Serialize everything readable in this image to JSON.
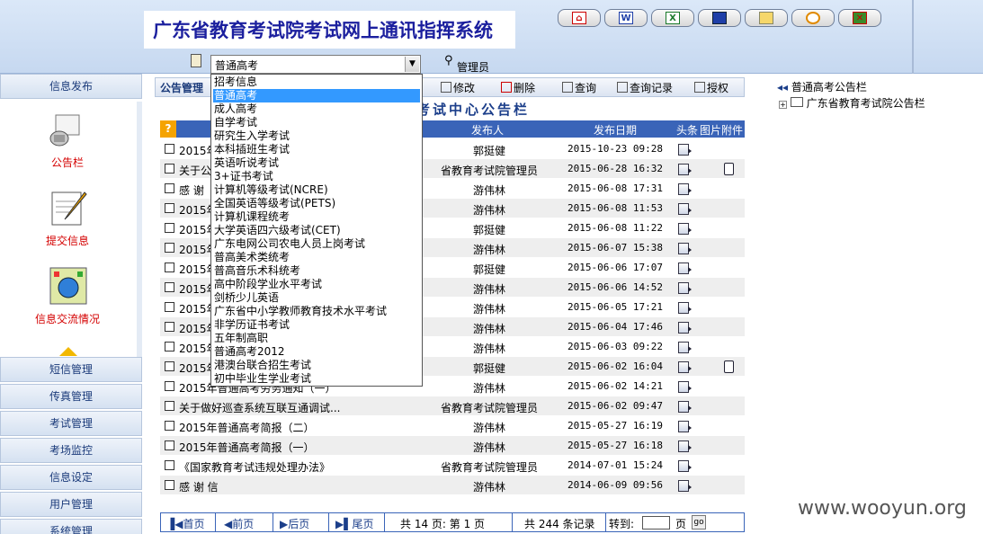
{
  "header": {
    "title": "广东省教育考试院考试网上通讯指挥系统",
    "toolbar_icons": [
      "home-icon",
      "word-icon",
      "excel-icon",
      "calendar-icon",
      "mail-icon",
      "clock-icon",
      "exit-icon"
    ]
  },
  "exam_select": {
    "value": "普通高考",
    "options": [
      "招考信息",
      "普通高考",
      "成人高考",
      "自学考试",
      "研究生入学考试",
      "本科插班生考试",
      "英语听说考试",
      "3+证书考试",
      "计算机等级考试(NCRE)",
      "全国英语等级考试(PETS)",
      "计算机课程统考",
      "大学英语四六级考试(CET)",
      "广东电网公司农电人员上岗考试",
      "普高美术类统考",
      "普高音乐术科统考",
      "高中阶段学业水平考试",
      "剑桥少儿英语",
      "广东省中小学教师教育技术水平考试",
      "非学历证书考试",
      "五年制高职",
      "普通高考2012",
      "港澳台联合招生考试",
      "初中毕业生学业考试"
    ],
    "selected_index": 1
  },
  "user": {
    "role": "管理员"
  },
  "sidebar": {
    "top": "信息发布",
    "items": [
      {
        "label": "公告栏",
        "icon": "megaphone-icon"
      },
      {
        "label": "提交信息",
        "icon": "notepad-icon"
      },
      {
        "label": "信息交流情况",
        "icon": "globe-icon"
      }
    ],
    "menus": [
      "短信管理",
      "传真管理",
      "考试管理",
      "考场监控",
      "信息设定",
      "用户管理",
      "系统管理"
    ]
  },
  "content": {
    "section_label": "公告管理",
    "tools": [
      "修改",
      "删除",
      "查询",
      "查询记录",
      "授权"
    ],
    "board_title": "考试中心公告栏",
    "columns": {
      "publisher": "发布人",
      "date": "发布日期",
      "headline": "头条",
      "image": "图片",
      "attachment": "附件"
    },
    "rows": [
      {
        "title": "2015年",
        "publisher": "郭挺健",
        "date": "2015-10-23 09:28",
        "attach": false
      },
      {
        "title": "关于公",
        "publisher": "省教育考试院管理员",
        "date": "2015-06-28 16:32",
        "attach": true
      },
      {
        "title": "感 谢",
        "publisher": "游伟林",
        "date": "2015-06-08 17:31",
        "attach": false
      },
      {
        "title": "2015年",
        "publisher": "游伟林",
        "date": "2015-06-08 11:53",
        "attach": false
      },
      {
        "title": "2015年",
        "publisher": "郭挺健",
        "date": "2015-06-08 11:22",
        "attach": false
      },
      {
        "title": "2015年",
        "publisher": "游伟林",
        "date": "2015-06-07 15:38",
        "attach": false
      },
      {
        "title": "2015年",
        "publisher": "郭挺健",
        "date": "2015-06-06 17:07",
        "attach": false
      },
      {
        "title": "2015年",
        "publisher": "游伟林",
        "date": "2015-06-06 14:52",
        "attach": false
      },
      {
        "title": "2015年",
        "publisher": "游伟林",
        "date": "2015-06-05 17:21",
        "attach": false
      },
      {
        "title": "2015年",
        "publisher": "游伟林",
        "date": "2015-06-04 17:46",
        "attach": false
      },
      {
        "title": "2015年",
        "publisher": "游伟林",
        "date": "2015-06-03 09:22",
        "attach": false
      },
      {
        "title": "2015年",
        "publisher": "郭挺健",
        "date": "2015-06-02 16:04",
        "attach": true
      },
      {
        "title": "2015年普通高考劳务通知（一）",
        "publisher": "游伟林",
        "date": "2015-06-02 14:21",
        "attach": false
      },
      {
        "title": "关于做好巡查系统互联互通调试...",
        "publisher": "省教育考试院管理员",
        "date": "2015-06-02 09:47",
        "attach": false
      },
      {
        "title": "2015年普通高考简报（二）",
        "publisher": "游伟林",
        "date": "2015-05-27 16:19",
        "attach": false
      },
      {
        "title": "2015年普通高考简报（一）",
        "publisher": "游伟林",
        "date": "2015-05-27 16:18",
        "attach": false
      },
      {
        "title": "《国家教育考试违规处理办法》",
        "publisher": "省教育考试院管理员",
        "date": "2014-07-01 15:24",
        "attach": false
      },
      {
        "title": "感 谢 信",
        "publisher": "游伟林",
        "date": "2014-06-09 09:56",
        "attach": false
      }
    ],
    "pager": {
      "first": "首页",
      "prev": "前页",
      "next": "后页",
      "last": "尾页",
      "summary": "共 14 页: 第 1 页",
      "total": "共 244 条记录",
      "goto_label": "转到:",
      "page_unit": "页",
      "go": "go"
    }
  },
  "tree": {
    "root": "普通高考公告栏",
    "child": "广东省教育考试院公告栏"
  },
  "watermark": "www.wooyun.org"
}
